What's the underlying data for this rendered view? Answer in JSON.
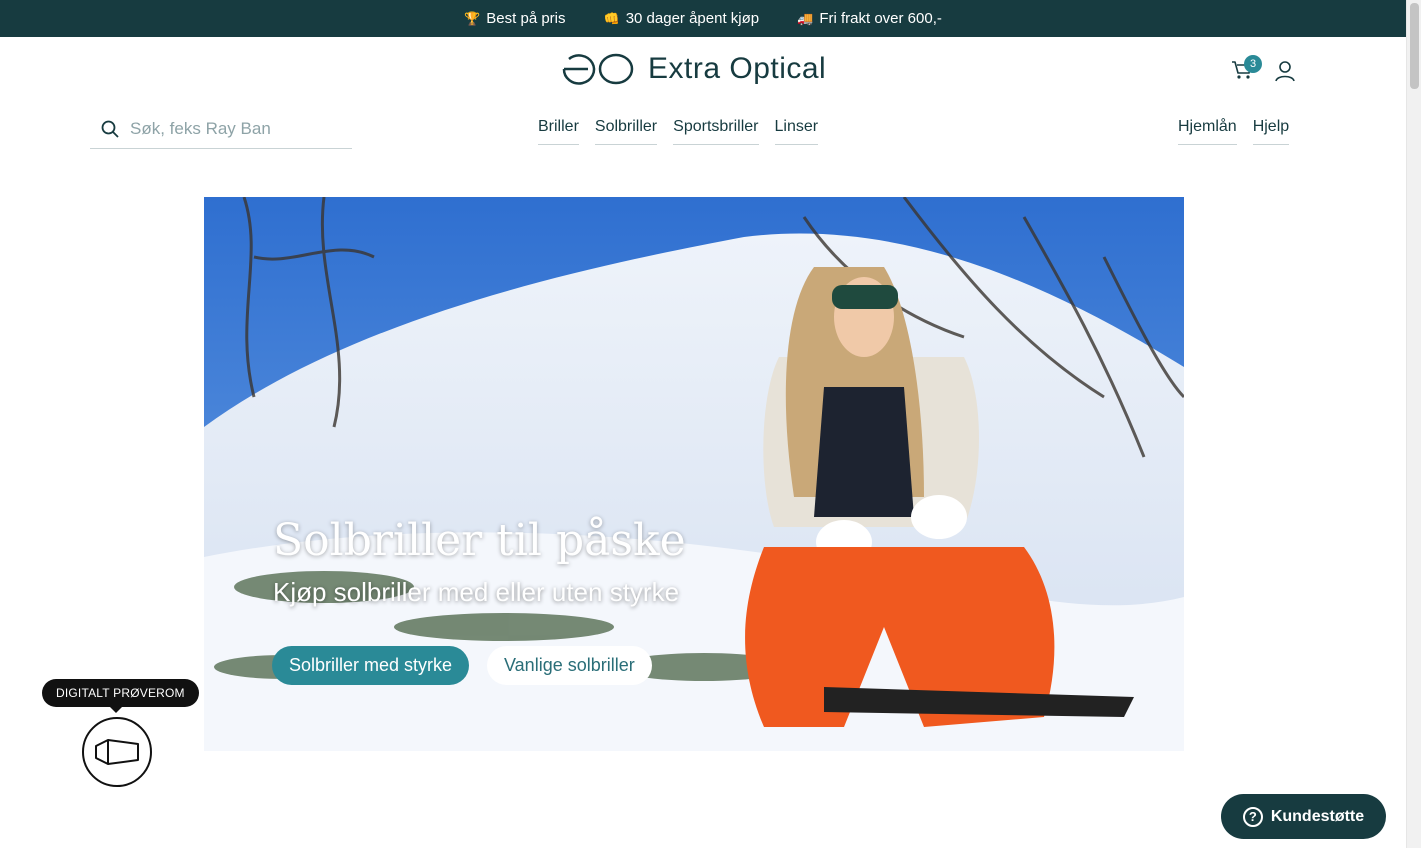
{
  "promo": {
    "items": [
      {
        "icon": "trophy-icon",
        "label": "Best på pris"
      },
      {
        "icon": "fist-icon",
        "label": "30 dager åpent kjøp"
      },
      {
        "icon": "truck-icon",
        "label": "Fri frakt over 600,-"
      }
    ]
  },
  "header": {
    "logo_text": "Extra Optical",
    "cart_count": "3"
  },
  "search": {
    "placeholder": "Søk, feks Ray Ban",
    "value": ""
  },
  "nav": {
    "main": [
      "Briller",
      "Solbriller",
      "Sportsbriller",
      "Linser"
    ],
    "right": [
      "Hjemlån",
      "Hjelp"
    ]
  },
  "hero": {
    "title": "Solbriller til påske",
    "subtitle": "Kjøp solbriller med eller uten styrke",
    "primary_button": "Solbriller med styrke",
    "secondary_button": "Vanlige solbriller"
  },
  "tryon": {
    "tooltip": "DIGITALT PRØVEROM"
  },
  "support": {
    "label": "Kundestøtte",
    "icon": "?"
  },
  "colors": {
    "brand_dark": "#173b40",
    "accent": "#2a8a97"
  }
}
